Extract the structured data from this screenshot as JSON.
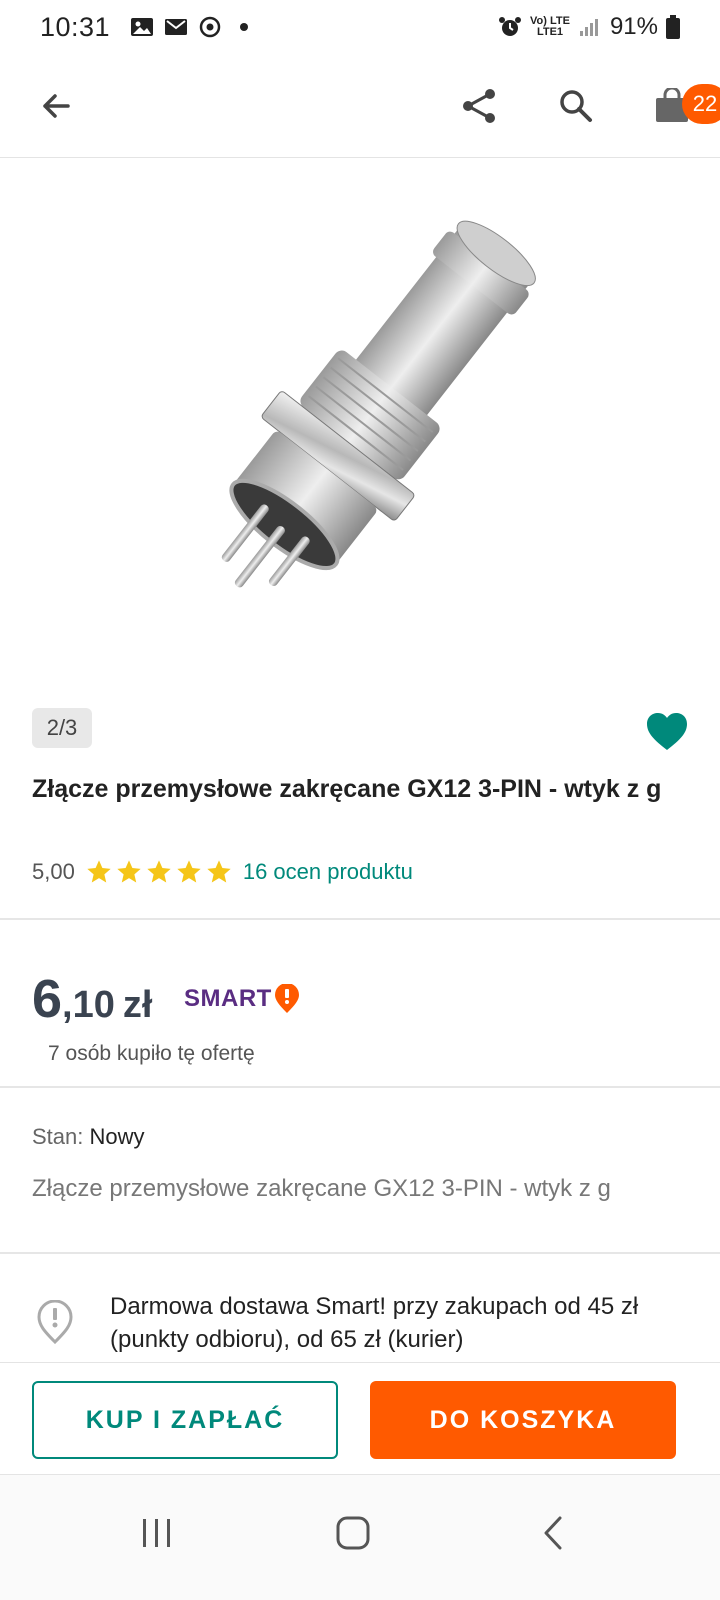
{
  "status_bar": {
    "time": "10:31",
    "signal_text_top": "Vo) LTE",
    "signal_text_bottom": "LTE1",
    "battery": "91%"
  },
  "app_bar": {
    "cart_count": "22"
  },
  "gallery": {
    "counter": "2/3"
  },
  "product": {
    "title": "Złącze przemysłowe zakręcane GX12 3-PIN - wtyk z g",
    "rating_value": "5,00",
    "stars": 5,
    "reviews_label": "16 ocen produktu",
    "price_int": "6",
    "price_frac": ",10",
    "currency": "zł",
    "smart_label": "SMART",
    "bought_label": "7 osób kupiło tę ofertę",
    "condition_label": "Stan:",
    "condition_value": "Nowy",
    "description": "Złącze przemysłowe zakręcane GX12 3-PIN - wtyk z g",
    "delivery_text": "Darmowa dostawa Smart! przy zakupach od 45 zł (punkty odbioru), od 65 zł (kurier)"
  },
  "actions": {
    "buy_label": "KUP I ZAPŁAĆ",
    "cart_label": "DO KOSZYKA"
  },
  "colors": {
    "accent_teal": "#00897b",
    "accent_orange": "#ff5a00",
    "star": "#f5c518",
    "smart_purple": "#5a2d82"
  }
}
